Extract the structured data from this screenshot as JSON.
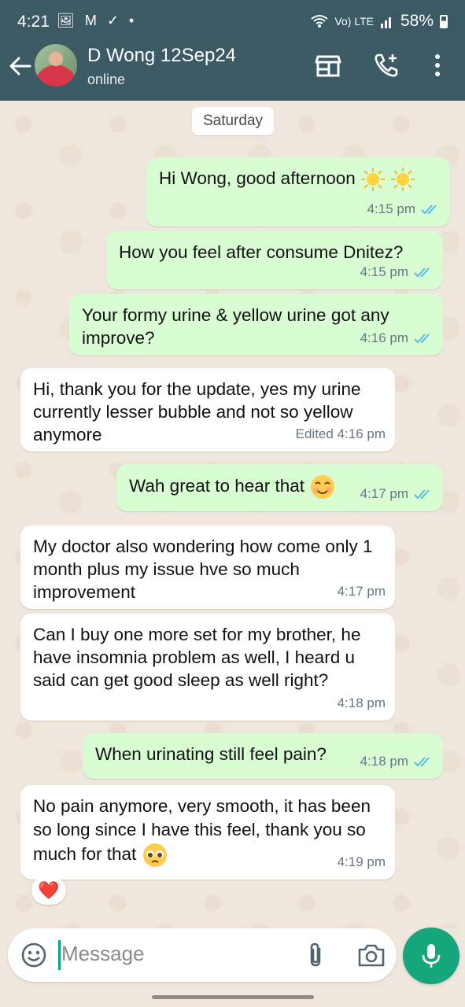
{
  "status_bar": {
    "time": "4:21",
    "left_icons": "🖼 M ✓ •",
    "signal_text": "Vo) LTE",
    "battery": "58%"
  },
  "header": {
    "contact_name": "D Wong 12Sep24",
    "contact_status": "online",
    "icons": [
      "back-arrow-icon",
      "store-icon",
      "add-call-icon",
      "more-vert-icon"
    ]
  },
  "chat": {
    "date_chip": "Saturday",
    "messages": [
      {
        "dir": "out",
        "text": "Hi Wong, good afternoon",
        "emoji": "☀️☀️",
        "time": "4:15 pm",
        "read": true
      },
      {
        "dir": "out",
        "text": "How you feel after consume Dnitez?",
        "time": "4:15 pm",
        "read": true
      },
      {
        "dir": "out",
        "text": "Your formy urine & yellow urine got any improve?",
        "time": "4:16 pm",
        "read": true
      },
      {
        "dir": "in",
        "text": "Hi, thank you for the update, yes my urine currently lesser bubble and not so yellow anymore",
        "time": "Edited 4:16 pm"
      },
      {
        "dir": "out",
        "text": "Wah great to hear that",
        "emoji": "☺️",
        "time": "4:17 pm",
        "read": true
      },
      {
        "dir": "in",
        "text": "My doctor also wondering how come only 1 month plus my issue hve so much improvement",
        "time": "4:17 pm"
      },
      {
        "dir": "in",
        "text": "Can I buy one more set for my brother, he have insomnia problem as well, I heard u said can get good sleep as well right?",
        "time": "4:18 pm"
      },
      {
        "dir": "out",
        "text": "When urinating still feel pain?",
        "time": "4:18 pm",
        "read": true
      },
      {
        "dir": "in",
        "text": "No pain anymore, very smooth, it has been so long since I have this feel, thank you so much for that",
        "emoji": "🥹",
        "time": "4:19 pm",
        "reaction": "❤️"
      }
    ]
  },
  "composer": {
    "placeholder": "Message",
    "icons": [
      "emoji-icon",
      "attach-icon",
      "camera-icon",
      "mic-icon"
    ]
  },
  "colors": {
    "header_bg": "#3b5a63",
    "outgoing_bubble": "#d9fdd3",
    "incoming_bubble": "#ffffff",
    "read_tick": "#53bdeb",
    "mic_button": "#16a67c"
  }
}
